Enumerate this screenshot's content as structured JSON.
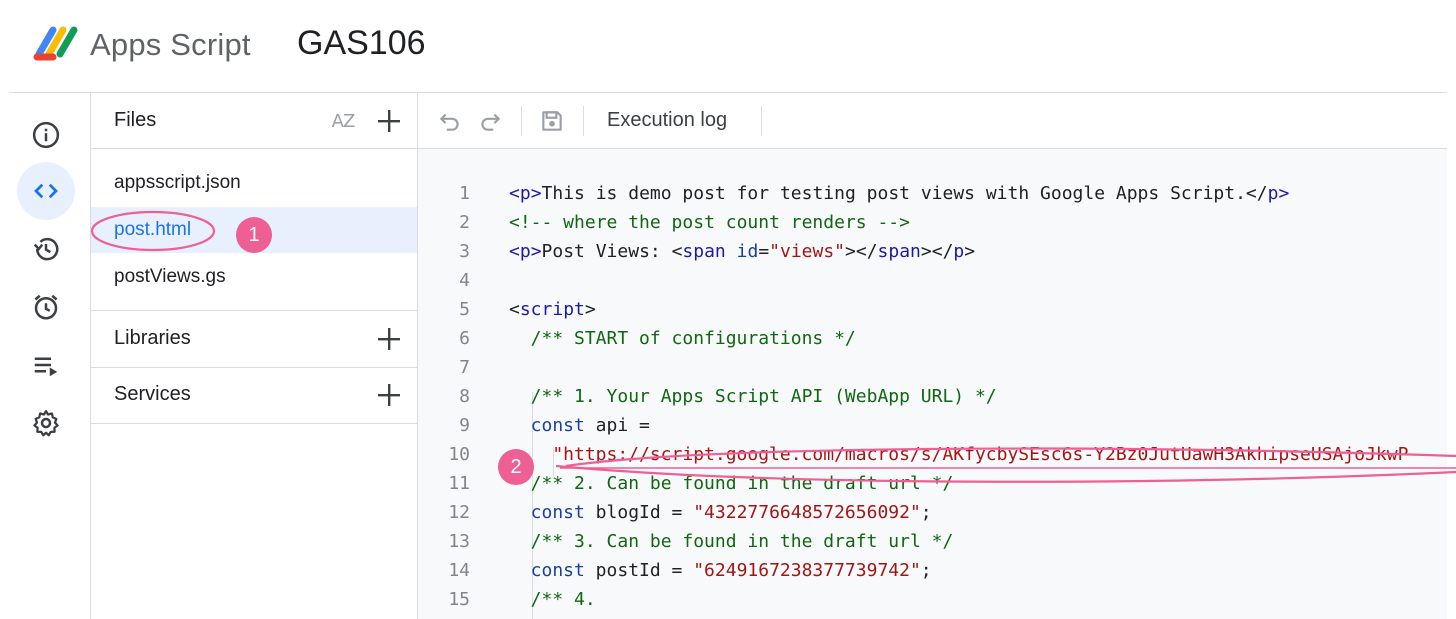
{
  "app": {
    "brand": "Apps Script",
    "project_name": "GAS106"
  },
  "rail": [
    {
      "icon": "info-icon",
      "active": false
    },
    {
      "icon": "code-icon",
      "active": true
    },
    {
      "icon": "history-icon",
      "active": false
    },
    {
      "icon": "alarm-clock-icon",
      "active": false
    },
    {
      "icon": "run-list-icon",
      "active": false
    },
    {
      "icon": "gear-icon",
      "active": false
    }
  ],
  "files_panel": {
    "title": "Files",
    "sort_icon_label": "AZ",
    "files": [
      {
        "name": "appsscript.json",
        "selected": false
      },
      {
        "name": "post.html",
        "selected": true
      },
      {
        "name": "postViews.gs",
        "selected": false
      }
    ],
    "sections": [
      {
        "label": "Libraries"
      },
      {
        "label": "Services"
      }
    ]
  },
  "toolbar": {
    "execution_log_label": "Execution log"
  },
  "annotations": [
    {
      "label": "1"
    },
    {
      "label": "2"
    }
  ],
  "accent_colors": {
    "selected": "#1a73e8",
    "annotation": "#ee5f93"
  },
  "code_lines": [
    {
      "n": "1",
      "indent": "",
      "tokens": [
        [
          "tag",
          "<"
        ],
        [
          "attr",
          "p"
        ],
        [
          "tag",
          ">"
        ],
        [
          "plain",
          "This is demo post for testing post views with Google Apps Script.</"
        ],
        [
          "attr",
          "p"
        ],
        [
          "tag",
          ">"
        ]
      ]
    },
    {
      "n": "2",
      "indent": "",
      "tokens": [
        [
          "com",
          "<!-- where the post count renders -->"
        ]
      ]
    },
    {
      "n": "3",
      "indent": "",
      "tokens": [
        [
          "tag",
          "<"
        ],
        [
          "attr",
          "p"
        ],
        [
          "tag",
          ">"
        ],
        [
          "plain",
          "Post Views: <"
        ],
        [
          "attr",
          "span"
        ],
        [
          "plain",
          " "
        ],
        [
          "key",
          "id"
        ],
        [
          "plain",
          "="
        ],
        [
          "str",
          "\"views\""
        ],
        [
          "plain",
          "></"
        ],
        [
          "attr",
          "span"
        ],
        [
          "plain",
          "></"
        ],
        [
          "attr",
          "p"
        ],
        [
          "plain",
          ">"
        ]
      ]
    },
    {
      "n": "4",
      "indent": "",
      "tokens": []
    },
    {
      "n": "5",
      "indent": "",
      "tokens": [
        [
          "plain",
          "<"
        ],
        [
          "attr",
          "script"
        ],
        [
          "plain",
          ">"
        ]
      ]
    },
    {
      "n": "6",
      "indent": "  ",
      "tokens": [
        [
          "com",
          "/** START of configurations */"
        ]
      ]
    },
    {
      "n": "7",
      "indent": "",
      "tokens": []
    },
    {
      "n": "8",
      "indent": "  ",
      "tokens": [
        [
          "com",
          "/** 1. Your Apps Script API (WebApp URL) */"
        ]
      ]
    },
    {
      "n": "9",
      "indent": "  ",
      "tokens": [
        [
          "key",
          "const"
        ],
        [
          "plain",
          " api ="
        ]
      ]
    },
    {
      "n": "10",
      "indent": "    ",
      "tokens": [
        [
          "str",
          "\"https://script.google.com/macros/s/AKfycbySEsc6s-Y2Bz0JutUawH3AkhipseUSAjoJkwP"
        ]
      ]
    },
    {
      "n": "11",
      "indent": "  ",
      "tokens": [
        [
          "com",
          "/** 2. Can be found in the draft url */"
        ]
      ]
    },
    {
      "n": "12",
      "indent": "  ",
      "tokens": [
        [
          "key",
          "const"
        ],
        [
          "plain",
          " blogId = "
        ],
        [
          "str",
          "\"4322776648572656092\""
        ],
        [
          "plain",
          ";"
        ]
      ]
    },
    {
      "n": "13",
      "indent": "  ",
      "tokens": [
        [
          "com",
          "/** 3. Can be found in the draft url */"
        ]
      ]
    },
    {
      "n": "14",
      "indent": "  ",
      "tokens": [
        [
          "key",
          "const"
        ],
        [
          "plain",
          " postId = "
        ],
        [
          "str",
          "\"6249167238377739742\""
        ],
        [
          "plain",
          ";"
        ]
      ]
    },
    {
      "n": "15",
      "indent": "  ",
      "tokens": [
        [
          "com",
          "/** 4."
        ]
      ]
    }
  ]
}
